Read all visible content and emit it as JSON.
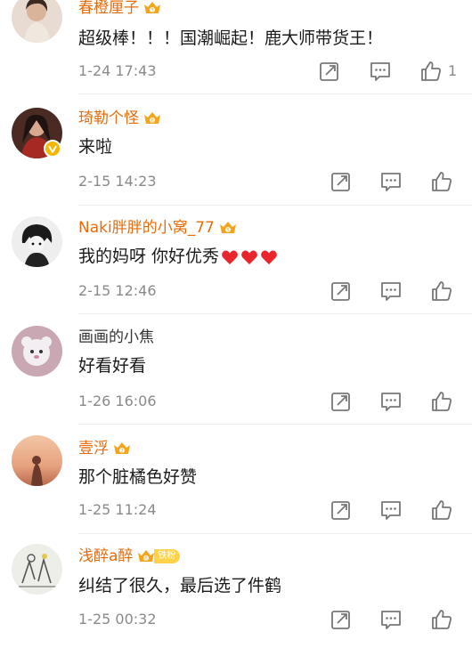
{
  "comments": [
    {
      "username": "春橙厘子",
      "text": "超级棒！！！国潮崛起！鹿大师带货王！",
      "time": "1-24 17:43",
      "like_count": "1"
    },
    {
      "username": "琦勒个怪",
      "text": "来啦",
      "time": "2-15 14:23",
      "like_count": ""
    },
    {
      "username": "Naki胖胖的小窝_77",
      "text": "我的妈呀 你好优秀",
      "time": "2-15 12:46",
      "like_count": ""
    },
    {
      "username": "画画的小焦",
      "text": "好看好看",
      "time": "1-26 16:06",
      "like_count": ""
    },
    {
      "username": "壹浮",
      "text": "那个脏橘色好赞",
      "time": "1-25 11:24",
      "like_count": ""
    },
    {
      "username": "浅醉a醉",
      "text": "纠结了很久，最后选了件鹤",
      "time": "1-25 00:32",
      "like_count": "",
      "fan_badge": "铁粉"
    }
  ],
  "colors": {
    "vip_name": "#e86b0c",
    "plain_name": "#333333",
    "icon_gray": "#777777",
    "heart": "#e8262b",
    "crown": "#f3a51c"
  },
  "icons": {
    "repost": "repost-icon",
    "comment": "comment-icon",
    "like": "like-icon",
    "crown": "vip-crown-icon",
    "verified": "verified-badge-icon",
    "heart": "heart-icon"
  }
}
